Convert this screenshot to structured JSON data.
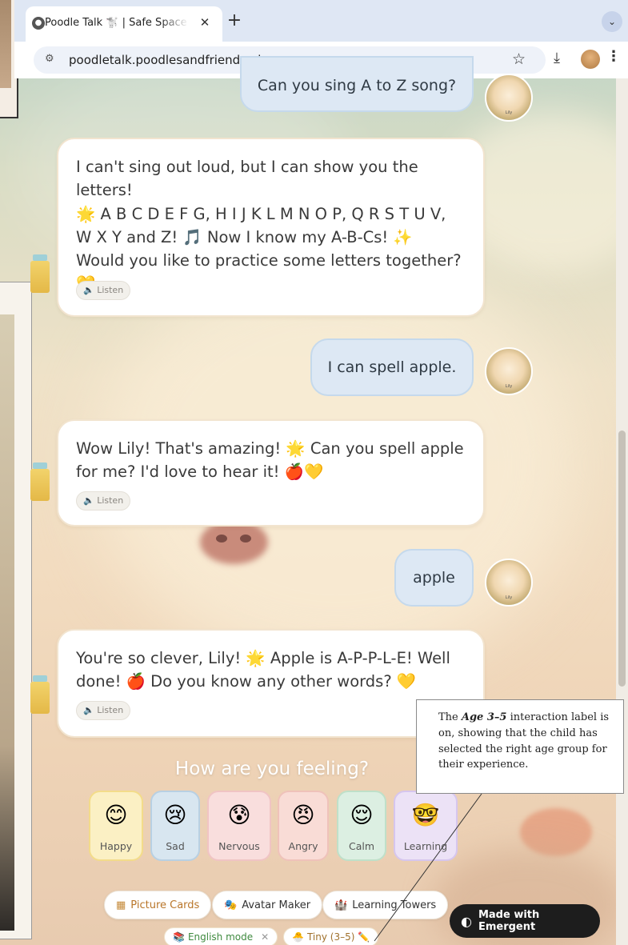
{
  "browser": {
    "tab_title": "Poodle Talk 🐩 | Safe Space fo",
    "tab_close": "✕",
    "new_tab": "+",
    "url": "poodletalk.poodlesandfriends.uk"
  },
  "messages": [
    {
      "role": "user",
      "text": "Can you sing A to Z song?"
    },
    {
      "role": "bot",
      "lines": [
        "I can't sing out loud, but I can show you the letters!",
        "🌟 A B C D E F G, H I J K L M N O P, Q R S T U V,",
        "W X Y and Z! 🎵 Now I know my A-B-Cs! ✨",
        "Would you like to practice some letters together?",
        "💛"
      ],
      "listen": "🔈 Listen"
    },
    {
      "role": "user",
      "text": "I can spell apple."
    },
    {
      "role": "bot",
      "lines": [
        "Wow Lily! That's amazing! 🌟 Can you spell apple",
        "for me? I'd love to hear it! 🍎💛"
      ],
      "listen": "🔈 Listen"
    },
    {
      "role": "user",
      "text": "apple"
    },
    {
      "role": "bot",
      "lines": [
        "You're so clever, Lily! 🌟 Apple is A-P-P-L-E! Well",
        "done! 🍎 Do you know any other words? 💛"
      ],
      "listen": "🔈 Listen"
    }
  ],
  "user_avatar_label": "Lily",
  "feelings": {
    "title": "How are you feeling?",
    "items": [
      {
        "face": "😊",
        "label": "Happy",
        "bg": "#fbf0c4",
        "border": "#f3dc8a"
      },
      {
        "face": "😢",
        "label": "Sad",
        "bg": "#d8e6f0",
        "border": "#b8d0e3"
      },
      {
        "face": "😰",
        "label": "Nervous",
        "bg": "#f9dedd",
        "border": "#f0c4c4"
      },
      {
        "face": "😠",
        "label": "Angry",
        "bg": "#f9dcd6",
        "border": "#efc2ba"
      },
      {
        "face": "😌",
        "label": "Calm",
        "bg": "#dcefe2",
        "border": "#bfe0c9"
      },
      {
        "face": "🤓",
        "label": "Learning",
        "bg": "#ece2f6",
        "border": "#d6c6ee"
      }
    ]
  },
  "actions": {
    "picture_cards": "Picture Cards",
    "avatar_maker": "Avatar Maker",
    "learning_towers": "Learning Towers"
  },
  "tags": {
    "english_mode": "English mode",
    "english_close": "✕",
    "age": "Tiny (3–5)"
  },
  "badge": "Made with Emergent",
  "annotation": {
    "pre": "The ",
    "em": "Age 3–5",
    "post": " interaction label is on, showing that the child has selected the right age group for their experience."
  }
}
